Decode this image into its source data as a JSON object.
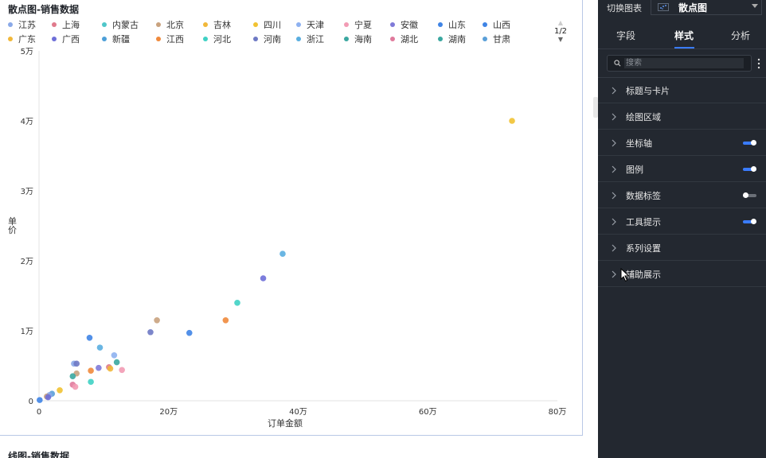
{
  "chart_title": "散点图-销售数据",
  "next_chart_title": "线图-销售数据",
  "legend": {
    "page": "1/2",
    "items": [
      {
        "name": "江苏",
        "color": "#8aa9e8"
      },
      {
        "name": "上海",
        "color": "#e07a8c"
      },
      {
        "name": "内蒙古",
        "color": "#4fc6c9"
      },
      {
        "name": "北京",
        "color": "#c9a27e"
      },
      {
        "name": "吉林",
        "color": "#f1b83a"
      },
      {
        "name": "四川",
        "color": "#f1c232"
      },
      {
        "name": "天津",
        "color": "#8eb1f0"
      },
      {
        "name": "宁夏",
        "color": "#f29bb4"
      },
      {
        "name": "安徽",
        "color": "#7f7ad8"
      },
      {
        "name": "山东",
        "color": "#3f84e5"
      },
      {
        "name": "山西",
        "color": "#3f84e5"
      },
      {
        "name": "广东",
        "color": "#f1b83a"
      },
      {
        "name": "广西",
        "color": "#6e6fd8"
      },
      {
        "name": "新疆",
        "color": "#4d9fd8"
      },
      {
        "name": "江西",
        "color": "#f08a3c"
      },
      {
        "name": "河北",
        "color": "#3fd1c4"
      },
      {
        "name": "河南",
        "color": "#6e79c4"
      },
      {
        "name": "浙江",
        "color": "#5aaee0"
      },
      {
        "name": "海南",
        "color": "#3aa7a0"
      },
      {
        "name": "湖北",
        "color": "#e07a9c"
      },
      {
        "name": "湖南",
        "color": "#3aa7a0"
      },
      {
        "name": "甘肃",
        "color": "#5a9fd8"
      }
    ]
  },
  "chart_data": {
    "type": "scatter",
    "title": "散点图-销售数据",
    "xlabel": "订单金额",
    "ylabel": "单价",
    "xlim": [
      0,
      800000
    ],
    "ylim": [
      0,
      50000
    ],
    "x_ticks": [
      "0",
      "20万",
      "40万",
      "60万",
      "80万"
    ],
    "y_ticks": [
      "0",
      "1万",
      "2万",
      "3万",
      "4万",
      "5万"
    ],
    "x_tick_values": [
      0,
      200000,
      400000,
      600000,
      800000
    ],
    "y_tick_values": [
      0,
      10000,
      20000,
      30000,
      40000,
      50000
    ],
    "grid": false,
    "legend_position": "top",
    "points": [
      {
        "x": 730000,
        "y": 40000,
        "color": "#f1c232"
      },
      {
        "x": 376000,
        "y": 21000,
        "color": "#5aaee0"
      },
      {
        "x": 346000,
        "y": 17500,
        "color": "#6e6fd8"
      },
      {
        "x": 306000,
        "y": 14000,
        "color": "#3fd1c4"
      },
      {
        "x": 288000,
        "y": 11500,
        "color": "#f08a3c"
      },
      {
        "x": 182000,
        "y": 11500,
        "color": "#c9a27e"
      },
      {
        "x": 232000,
        "y": 9700,
        "color": "#3f84e5"
      },
      {
        "x": 172000,
        "y": 9800,
        "color": "#6e79c4"
      },
      {
        "x": 78000,
        "y": 9000,
        "color": "#3f84e5"
      },
      {
        "x": 94000,
        "y": 7600,
        "color": "#5aaee0"
      },
      {
        "x": 116000,
        "y": 6500,
        "color": "#8eb1f0"
      },
      {
        "x": 120000,
        "y": 5500,
        "color": "#3aa7a0"
      },
      {
        "x": 54000,
        "y": 5300,
        "color": "#8aa9e8"
      },
      {
        "x": 58000,
        "y": 5300,
        "color": "#6e79c4"
      },
      {
        "x": 108000,
        "y": 4800,
        "color": "#e07a8c"
      },
      {
        "x": 92000,
        "y": 4700,
        "color": "#7f7ad8"
      },
      {
        "x": 110000,
        "y": 4600,
        "color": "#f1b83a"
      },
      {
        "x": 128000,
        "y": 4400,
        "color": "#f29bb4"
      },
      {
        "x": 80000,
        "y": 4300,
        "color": "#f08a3c"
      },
      {
        "x": 58000,
        "y": 3900,
        "color": "#c9a27e"
      },
      {
        "x": 52000,
        "y": 3500,
        "color": "#3aa7a0"
      },
      {
        "x": 80000,
        "y": 2700,
        "color": "#3fd1c4"
      },
      {
        "x": 52000,
        "y": 2300,
        "color": "#e07a9c"
      },
      {
        "x": 56000,
        "y": 2000,
        "color": "#f29bb4"
      },
      {
        "x": 32000,
        "y": 1500,
        "color": "#f1c232"
      },
      {
        "x": 20000,
        "y": 1000,
        "color": "#5a9fd8"
      },
      {
        "x": 16000,
        "y": 800,
        "color": "#8aa9e8"
      },
      {
        "x": 12000,
        "y": 600,
        "color": "#c9a27e"
      },
      {
        "x": 14000,
        "y": 500,
        "color": "#6e6fd8"
      },
      {
        "x": 1000,
        "y": 100,
        "color": "#3f84e5"
      }
    ]
  },
  "side": {
    "switch_label": "切换图表",
    "chart_type": "散点图",
    "tabs": [
      "字段",
      "样式",
      "分析"
    ],
    "active_tab": "样式",
    "search_placeholder": "搜索",
    "sections": [
      {
        "label": "标题与卡片",
        "toggle": null
      },
      {
        "label": "绘图区域",
        "toggle": null
      },
      {
        "label": "坐标轴",
        "toggle": "on"
      },
      {
        "label": "图例",
        "toggle": "on"
      },
      {
        "label": "数据标签",
        "toggle": "off"
      },
      {
        "label": "工具提示",
        "toggle": "on"
      },
      {
        "label": "系列设置",
        "toggle": null
      },
      {
        "label": "辅助展示",
        "toggle": null
      }
    ]
  }
}
